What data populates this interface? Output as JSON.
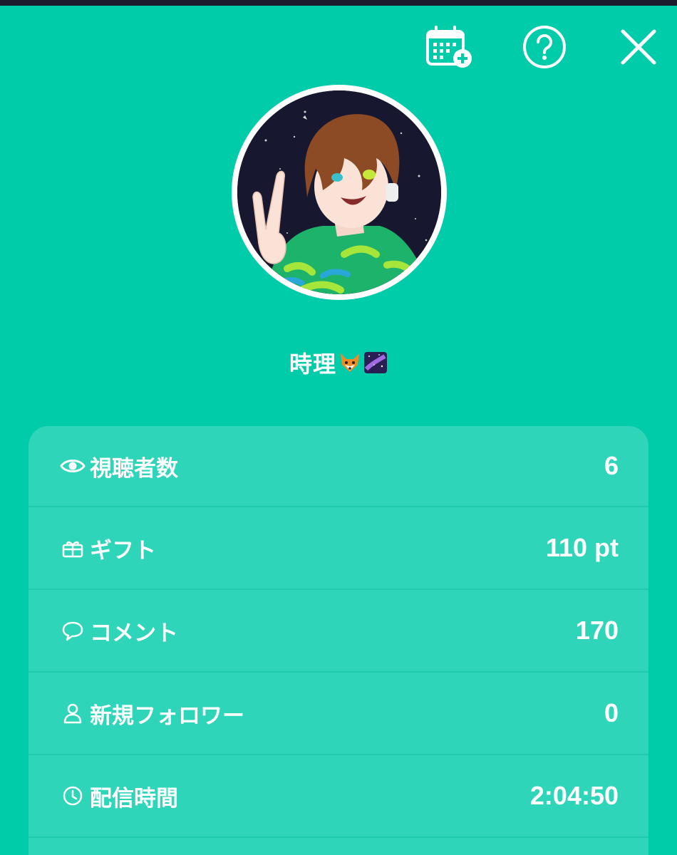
{
  "header": {
    "calendar_icon": "calendar-add-icon",
    "help_icon": "help-circle-icon",
    "close_icon": "close-icon"
  },
  "profile": {
    "username": "時理",
    "username_emojis": [
      "fox-emoji",
      "galaxy-emoji"
    ]
  },
  "stats": [
    {
      "icon": "eye-icon",
      "label": "視聴者数",
      "value": "6"
    },
    {
      "icon": "gift-icon",
      "label": "ギフト",
      "value": "110 pt"
    },
    {
      "icon": "comment-icon",
      "label": "コメント",
      "value": "170"
    },
    {
      "icon": "person-icon",
      "label": "新規フォロワー",
      "value": "0"
    },
    {
      "icon": "clock-icon",
      "label": "配信時間",
      "value": "2:04:50"
    }
  ],
  "colors": {
    "background": "#00ccaa",
    "card": "rgba(255,255,255,0.18)",
    "text": "#ffffff"
  }
}
